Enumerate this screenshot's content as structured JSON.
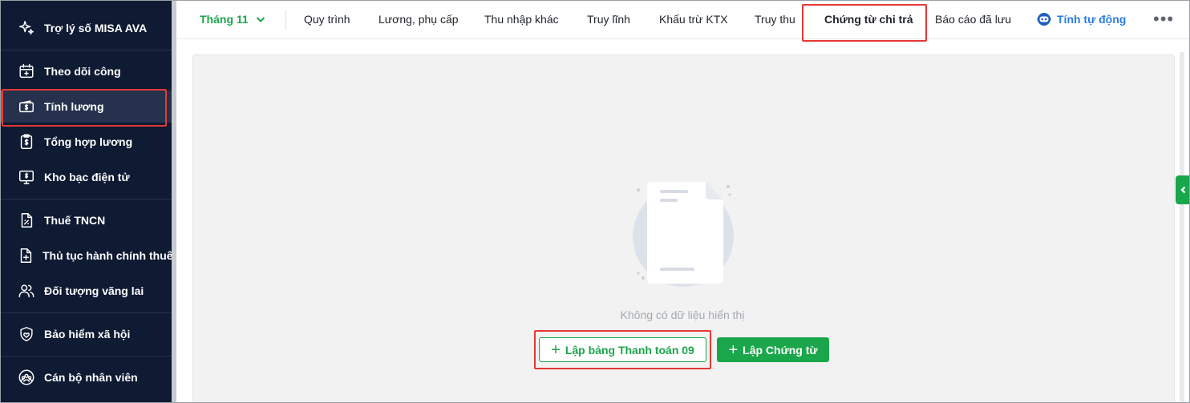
{
  "sidebar": {
    "assistant": "Trợ lý số MISA AVA",
    "items": [
      {
        "label": "Theo dõi công",
        "icon": "calendar-icon"
      },
      {
        "label": "Tính lương",
        "icon": "money-icon"
      },
      {
        "label": "Tổng hợp lương",
        "icon": "payroll-summary-icon"
      },
      {
        "label": "Kho bạc điện tử",
        "icon": "treasury-monitor-icon"
      },
      {
        "label": "Thuế TNCN",
        "icon": "tax-document-icon"
      },
      {
        "label": "Thủ tục hành chính thuế",
        "icon": "file-plus-icon"
      },
      {
        "label": "Đối tượng vãng lai",
        "icon": "users-icon"
      },
      {
        "label": "Bảo hiểm xã hội",
        "icon": "shield-heart-icon"
      },
      {
        "label": "Cán bộ nhân viên",
        "icon": "staff-group-icon"
      }
    ],
    "active_index": 1
  },
  "topbar": {
    "month": "Tháng 11",
    "tabs": [
      "Quy trình",
      "Lương, phụ cấp",
      "Thu nhập khác",
      "Truy lĩnh",
      "Khấu trừ KTX",
      "Truy thu",
      "Chứng từ chi trả",
      "Báo cáo đã lưu"
    ],
    "active_tab": "Chứng từ chi trả",
    "auto_calc": "Tính tự động",
    "more": "•••"
  },
  "content": {
    "empty_text": "Không có dữ liệu hiển thị",
    "btn_payment_table": "Lập bảng Thanh toán 09",
    "btn_voucher": "Lập Chứng từ",
    "plus": "+"
  },
  "colors": {
    "sidebar_bg": "#0f1a33",
    "accent_green": "#1aa64a",
    "link_blue": "#2a7de1",
    "highlight_red": "#e53935"
  }
}
